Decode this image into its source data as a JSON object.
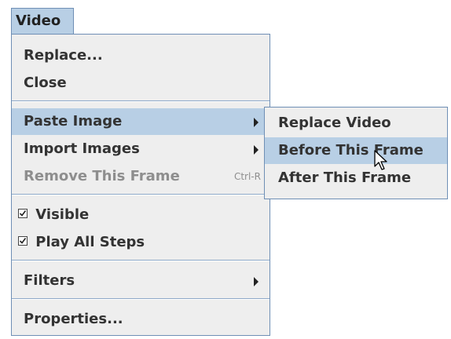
{
  "menubar": {
    "video_label": "Video"
  },
  "menu": {
    "replace_label": "Replace...",
    "close_label": "Close",
    "paste_image_label": "Paste Image",
    "import_images_label": "Import Images",
    "remove_frame_label": "Remove This Frame",
    "remove_frame_shortcut": "Ctrl-R",
    "visible_label": "Visible",
    "visible_checked": true,
    "play_all_steps_label": "Play All Steps",
    "play_all_steps_checked": true,
    "filters_label": "Filters",
    "properties_label": "Properties..."
  },
  "submenu": {
    "replace_video_label": "Replace Video",
    "before_frame_label": "Before This Frame",
    "after_frame_label": "After This Frame"
  },
  "colors": {
    "highlight": "#b8cfe5",
    "menu_background": "#eeeeee",
    "border": "#6f8fb5",
    "disabled_text": "#8e8e8e"
  },
  "icons": {
    "submenu_arrow": "triangle-right-icon",
    "checkbox": "checkmark-icon",
    "cursor": "mouse-pointer-icon"
  }
}
